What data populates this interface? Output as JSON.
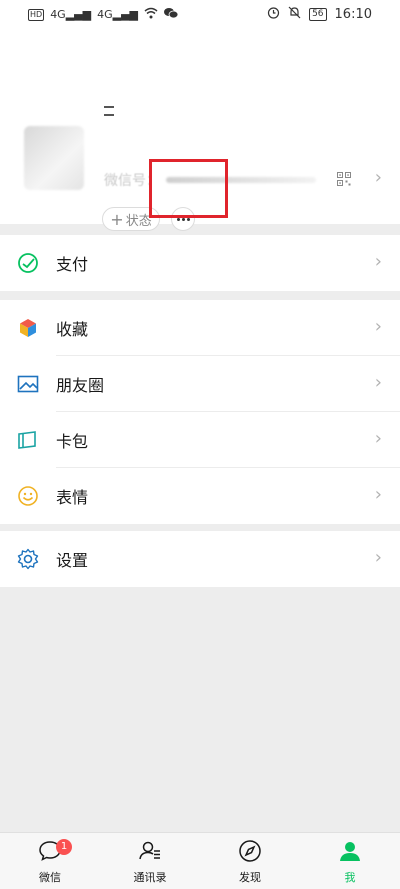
{
  "statusbar": {
    "left_icons": [
      "hd-icon",
      "signal-icon",
      "signal-icon",
      "wifi-icon",
      "wechat-notif-icon"
    ],
    "hd": "HD",
    "signal1": "4G",
    "signal2": "4G",
    "battery": "56",
    "time": "16:10"
  },
  "profile": {
    "wxid_label": "微信号：",
    "status_button": "状态",
    "status_plus": "+"
  },
  "menu": {
    "pay": "支付",
    "favorites": "收藏",
    "moments": "朋友圈",
    "cards": "卡包",
    "stickers": "表情",
    "settings": "设置"
  },
  "tabbar": {
    "chats": "微信",
    "chats_badge": "1",
    "contacts": "通讯录",
    "discover": "发现",
    "me": "我",
    "active_color": "#07c160"
  },
  "colors": {
    "highlight": "#e0242c",
    "pay_green": "#07c160",
    "moments_blue": "#1e73be",
    "cards_teal": "#1aa3a3",
    "stickers_yellow": "#f0b224",
    "settings_blue": "#1e73be"
  }
}
